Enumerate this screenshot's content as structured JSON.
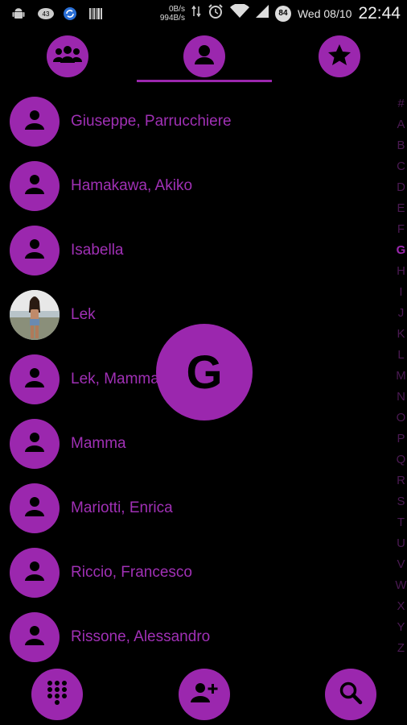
{
  "status_bar": {
    "net_up": "0B/s",
    "net_down": "994B/s",
    "date": "Wed 08/10",
    "time": "22:44",
    "battery": "84",
    "notification_badge": "43"
  },
  "tabs": [
    {
      "icon": "groups-icon"
    },
    {
      "icon": "person-icon",
      "selected": true
    },
    {
      "icon": "star-icon"
    }
  ],
  "contacts": [
    {
      "name": "Giuseppe, Parrucchiere",
      "avatar": "default"
    },
    {
      "name": "Hamakawa, Akiko",
      "avatar": "default"
    },
    {
      "name": "Isabella",
      "avatar": "default"
    },
    {
      "name": "Lek",
      "avatar": "photo"
    },
    {
      "name": "Lek, Mamma",
      "avatar": "default"
    },
    {
      "name": "Mamma",
      "avatar": "default"
    },
    {
      "name": "Mariotti, Enrica",
      "avatar": "default"
    },
    {
      "name": "Riccio, Francesco",
      "avatar": "default"
    },
    {
      "name": "Rissone, Alessandro",
      "avatar": "default"
    }
  ],
  "index_letters": [
    "#",
    "A",
    "B",
    "C",
    "D",
    "E",
    "F",
    "G",
    "H",
    "I",
    "J",
    "K",
    "L",
    "M",
    "N",
    "O",
    "P",
    "Q",
    "R",
    "S",
    "T",
    "U",
    "V",
    "W",
    "X",
    "Y",
    "Z"
  ],
  "index_active": "G",
  "bubble_letter": "G",
  "bottom_actions": [
    {
      "icon": "dialpad-icon"
    },
    {
      "icon": "add-contact-icon"
    },
    {
      "icon": "search-icon"
    }
  ],
  "colors": {
    "accent": "#9b27ae",
    "background": "#000000"
  }
}
